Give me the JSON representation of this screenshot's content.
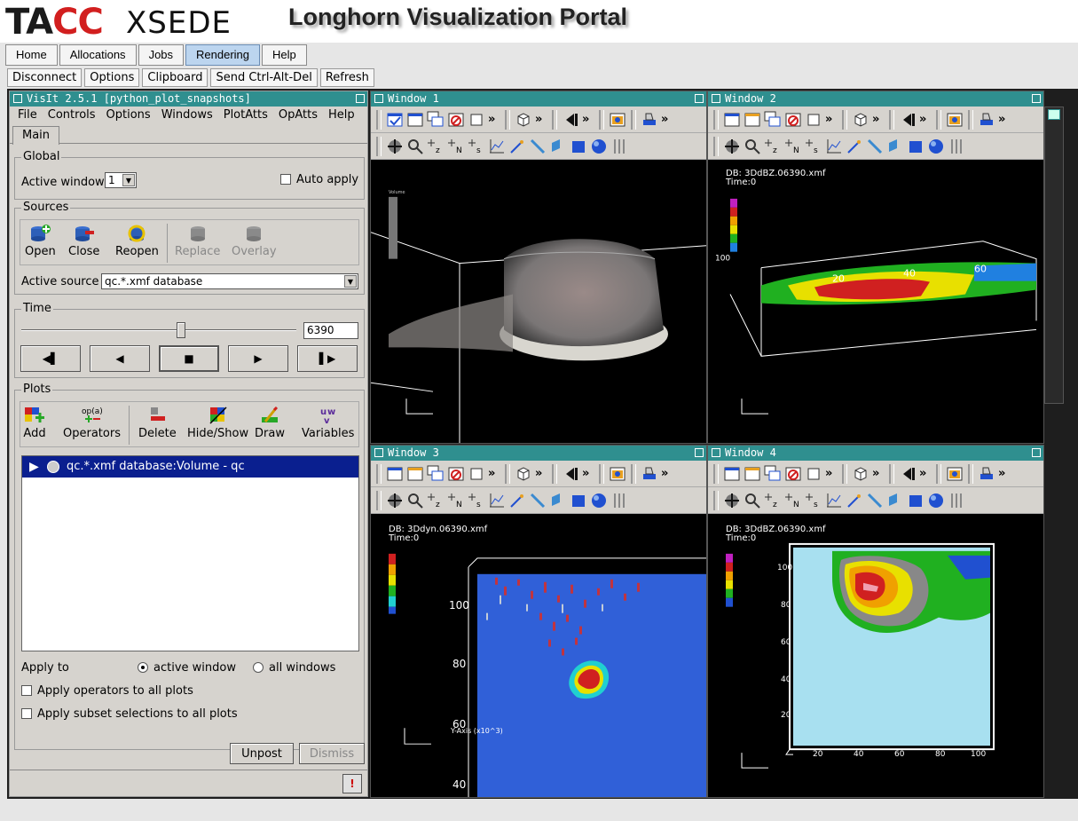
{
  "header": {
    "logo_tacc_prefix": "TA",
    "logo_tacc_red": "CC",
    "logo_xsede": "XSEDE",
    "title": "Longhorn Visualization Portal"
  },
  "nav": {
    "tabs": [
      "Home",
      "Allocations",
      "Jobs",
      "Rendering",
      "Help"
    ],
    "active": "Rendering"
  },
  "toolbar": [
    "Disconnect",
    "Options",
    "Clipboard",
    "Send Ctrl-Alt-Del",
    "Refresh"
  ],
  "gui": {
    "title": "VisIt 2.5.1 [python_plot_snapshots]",
    "menu": [
      "File",
      "Controls",
      "Options",
      "Windows",
      "PlotAtts",
      "OpAtts",
      "Help"
    ],
    "tab": "Main",
    "global": {
      "label": "Global",
      "active_window_label": "Active window",
      "active_window_value": "1",
      "auto_apply": "Auto apply"
    },
    "sources": {
      "label": "Sources",
      "buttons": [
        "Open",
        "Close",
        "Reopen",
        "Replace",
        "Overlay"
      ],
      "active_source_label": "Active source",
      "active_source_value": "qc.*.xmf database"
    },
    "time": {
      "label": "Time",
      "value": "6390",
      "slider_fraction": 0.58
    },
    "plots": {
      "label": "Plots",
      "buttons": [
        "Add",
        "Operators",
        "Delete",
        "Hide/Show",
        "Draw",
        "Variables"
      ],
      "operators_icon_text": "op(a)",
      "item": "qc.*.xmf database:Volume - qc",
      "apply_to": "Apply to",
      "active_window": "active window",
      "all_windows": "all windows",
      "apply_operators": "Apply operators to all plots",
      "apply_subset": "Apply subset selections to all plots"
    },
    "unpost": "Unpost",
    "dismiss": "Dismiss"
  },
  "windows": {
    "w1": {
      "title": "Window 1"
    },
    "w2": {
      "title": "Window 2",
      "db": "DB: 3DdBZ.06390.xmf",
      "time": "Time:0"
    },
    "w3": {
      "title": "Window 3",
      "db": "DB: 3Ddyn.06390.xmf",
      "time": "Time:0",
      "ticks": [
        "100",
        "80",
        "60",
        "40"
      ],
      "axis": "Y-Axis (x10^3)"
    },
    "w4": {
      "title": "Window 4",
      "db": "DB: 3DdBZ.06390.xmf",
      "time": "Time:0",
      "xticks": [
        "20",
        "40",
        "60",
        "80",
        "100"
      ],
      "yticks": [
        "100",
        "80",
        "60",
        "40",
        "20"
      ]
    }
  },
  "colors": {
    "titlebar": "#2f8f8f",
    "gui_bg": "#d6d3ce",
    "selected_row": "#0a1f8f",
    "nav_active": "#bcd5ef"
  }
}
